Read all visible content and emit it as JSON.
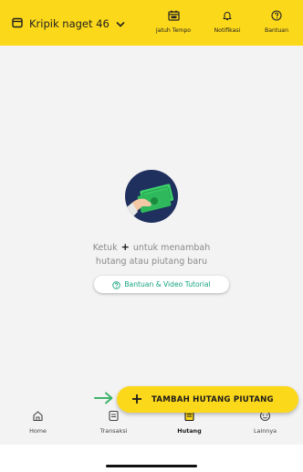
{
  "colors": {
    "brand_yellow": "#fcd81b",
    "accent_green": "#14a37f",
    "illustration_bg": "#1f2f5e"
  },
  "header": {
    "store_name": "Kripik naget 46",
    "store_icon": "store-icon",
    "dropdown_icon": "chevron-down-icon",
    "actions": [
      {
        "label": "Jatuh Tempo",
        "icon": "calendar-icon"
      },
      {
        "label": "Notifikasi",
        "icon": "bell-icon"
      },
      {
        "label": "Bantuan",
        "icon": "help-circle-icon"
      }
    ]
  },
  "empty_state": {
    "illustration": "hand-holding-money-icon",
    "line1_before": "Ketuk",
    "line1_plus": "+",
    "line1_after": "untuk menambah",
    "line2": "hutang atau piutang baru",
    "help_button": {
      "label": "Bantuan & Video Tutorial",
      "icon": "help-circle-icon"
    }
  },
  "fab": {
    "label": "TAMBAH HUTANG PIUTANG",
    "icon": "plus-icon",
    "pointer_icon": "arrow-right-icon"
  },
  "bottom_nav": {
    "items": [
      {
        "label": "Home",
        "icon": "home-icon",
        "active": false
      },
      {
        "label": "Transaksi",
        "icon": "receipt-icon",
        "active": false
      },
      {
        "label": "Hutang",
        "icon": "debt-book-icon",
        "active": true
      },
      {
        "label": "Lainnya",
        "icon": "more-icon",
        "active": false
      }
    ]
  }
}
